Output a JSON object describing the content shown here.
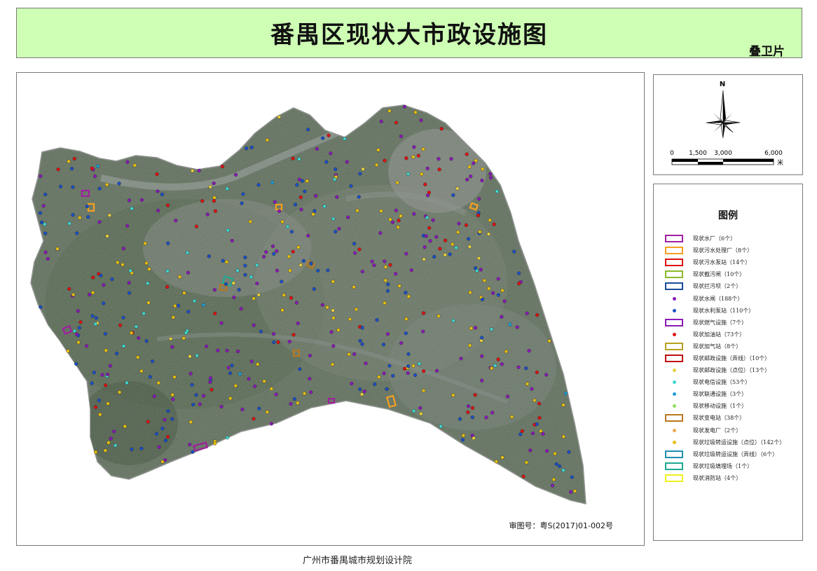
{
  "header": {
    "title": "番禺区现状大市政设施图",
    "subtitle": "叠卫片"
  },
  "map": {
    "approval_number": "审图号：粤S(2017)01-002号"
  },
  "north_arrow": {
    "label": "N"
  },
  "scale_bar": {
    "ticks": [
      "0",
      "1,500",
      "3,000",
      "6,000"
    ],
    "unit": "米"
  },
  "legend": {
    "title": "图例",
    "items": [
      {
        "symbol": "rect",
        "color": "#a020a0",
        "label": "现状水厂（6个）"
      },
      {
        "symbol": "rect",
        "color": "#f5a020",
        "label": "现状污水处理厂（8个）"
      },
      {
        "symbol": "rect",
        "color": "#e01010",
        "label": "现状污水泵站（14个）"
      },
      {
        "symbol": "rect",
        "color": "#8cb828",
        "label": "现状截污闸（10个）"
      },
      {
        "symbol": "rect",
        "color": "#1a4e9a",
        "label": "现状拦污坝（2个）"
      },
      {
        "symbol": "dot",
        "color": "#8a1ab8",
        "label": "现状水闸（188个）"
      },
      {
        "symbol": "dot",
        "color": "#1a50c8",
        "label": "现状水利泵站（110个）"
      },
      {
        "symbol": "rect",
        "color": "#8a1ab8",
        "label": "现状燃气设施（7个）"
      },
      {
        "symbol": "dot",
        "color": "#e01010",
        "label": "现状加油站（73个）"
      },
      {
        "symbol": "rect",
        "color": "#b8a020",
        "label": "现状加气站（8个）"
      },
      {
        "symbol": "rect",
        "color": "#c01010",
        "label": "现状邮政设施（弄线）（10个）"
      },
      {
        "symbol": "dot",
        "color": "#e8d040",
        "label": "现状邮政设施（点位）（13个）"
      },
      {
        "symbol": "dot",
        "color": "#40d8d0",
        "label": "现状电信设施（53个）"
      },
      {
        "symbol": "dot",
        "color": "#20a0d8",
        "label": "现状联通设施（3个）"
      },
      {
        "symbol": "dot",
        "color": "#90e060",
        "label": "现状移动设施（1个）"
      },
      {
        "symbol": "rect",
        "color": "#b87820",
        "label": "现状变电站（38个）"
      },
      {
        "symbol": "dot",
        "color": "#f0a850",
        "label": "现状发电厂（2个）"
      },
      {
        "symbol": "dot",
        "color": "#e8c010",
        "label": "现状垃圾转运设施（点位）（142个）"
      },
      {
        "symbol": "rect",
        "color": "#2090b0",
        "label": "现状垃圾转运设施（弄线）（6个）"
      },
      {
        "symbol": "rect",
        "color": "#20a890",
        "label": "现状垃圾填埋场（1个）"
      },
      {
        "symbol": "rect",
        "color": "#f0f020",
        "label": "现状消防站（4个）"
      }
    ]
  },
  "footer": {
    "credit": "广州市番禺城市规划设计院"
  }
}
